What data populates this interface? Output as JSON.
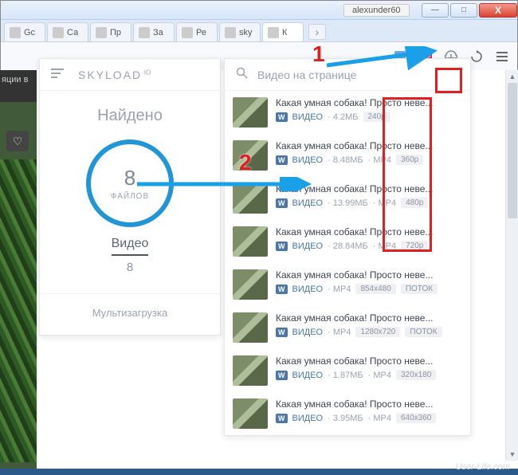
{
  "window": {
    "user_badge": "alexunder60",
    "buttons": {
      "min": "—",
      "max": "□",
      "close": "X"
    }
  },
  "tabs": [
    {
      "label": "Gc",
      "favicon": "fav-g"
    },
    {
      "label": "Са",
      "favicon": "fav-c"
    },
    {
      "label": "Пр",
      "favicon": "fav-c"
    },
    {
      "label": "За",
      "favicon": "fav-or"
    },
    {
      "label": "Ре",
      "favicon": "fav-or"
    },
    {
      "label": "sky",
      "favicon": "fav-g"
    },
    {
      "label": "К",
      "favicon": "fav-vk",
      "active": true
    }
  ],
  "toolbar": {
    "ext_badge": "8"
  },
  "left_strip": {
    "caption": "яции в"
  },
  "popup": {
    "brand": "SKYLOAD",
    "brand_sup": "·IO",
    "found_label": "Найдено",
    "count": "8",
    "count_label": "ФАЙЛОВ",
    "video_label": "Видео",
    "video_count": "8",
    "multidl": "Мультизагрузка"
  },
  "list": {
    "header": "Видео на странице",
    "items": [
      {
        "title": "Какая умная собака! Просто неве...",
        "source": "ВИДЕО",
        "size": "4.2МБ",
        "fmt": "",
        "chips": [
          "240p"
        ]
      },
      {
        "title": "Какая умная собака! Просто неве...",
        "source": "ВИДЕО",
        "size": "8.48МБ",
        "fmt": "MP4",
        "chips": [
          "360p"
        ]
      },
      {
        "title": "Какая умная собака! Просто неве...",
        "source": "ВИДЕО",
        "size": "13.99МБ",
        "fmt": "MP4",
        "chips": [
          "480p"
        ]
      },
      {
        "title": "Какая умная собака! Просто неве...",
        "source": "ВИДЕО",
        "size": "28.84МБ",
        "fmt": "MP4",
        "chips": [
          "720p"
        ]
      },
      {
        "title": "Какая умная собака! Просто неве...",
        "source": "ВИДЕО",
        "size": "",
        "fmt": "MP4",
        "chips": [
          "854x480",
          "ПОТОК"
        ]
      },
      {
        "title": "Какая умная собака! Просто неве...",
        "source": "ВИДЕО",
        "size": "",
        "fmt": "MP4",
        "chips": [
          "1280x720",
          "ПОТОК"
        ]
      },
      {
        "title": "Какая умная собака! Просто неве...",
        "source": "ВИДЕО",
        "size": "1.87МБ",
        "fmt": "MP4",
        "chips": [
          "320x180"
        ]
      },
      {
        "title": "Какая умная собака! Просто неве...",
        "source": "ВИДЕО",
        "size": "3.95МБ",
        "fmt": "MP4",
        "chips": [
          "640x360"
        ]
      }
    ]
  },
  "annotations": {
    "num1": "1",
    "num2": "2"
  },
  "watermark": "User-Life.com"
}
